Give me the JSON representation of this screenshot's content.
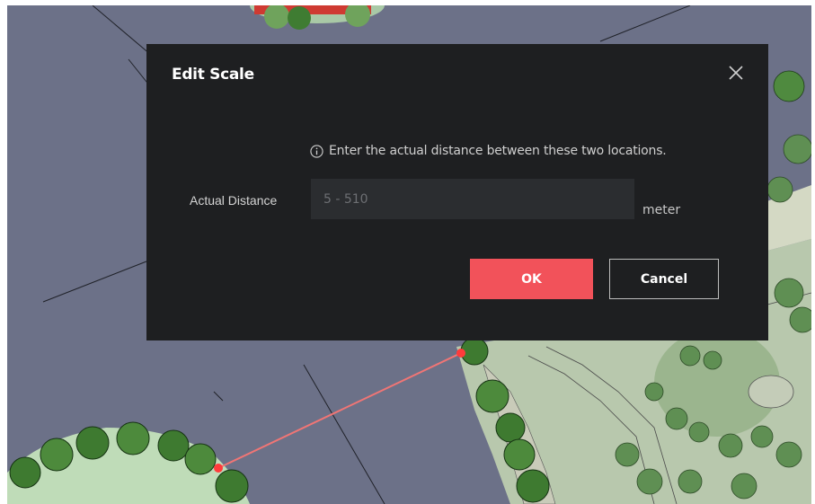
{
  "dialog": {
    "title": "Edit Scale",
    "hint": "Enter the actual distance between these two locations.",
    "distance_label": "Actual Distance",
    "distance_placeholder": "5 - 510",
    "distance_value": "",
    "unit": "meter",
    "ok_label": "OK",
    "cancel_label": "Cancel"
  },
  "icons": {
    "close": "close-icon",
    "info": "info-icon"
  },
  "colors": {
    "dialog_background": "#1e1f21",
    "input_background": "#2b2d30",
    "ok_button": "#f2525a",
    "map_background": "#6c7188",
    "measure_line": "#f07575"
  }
}
